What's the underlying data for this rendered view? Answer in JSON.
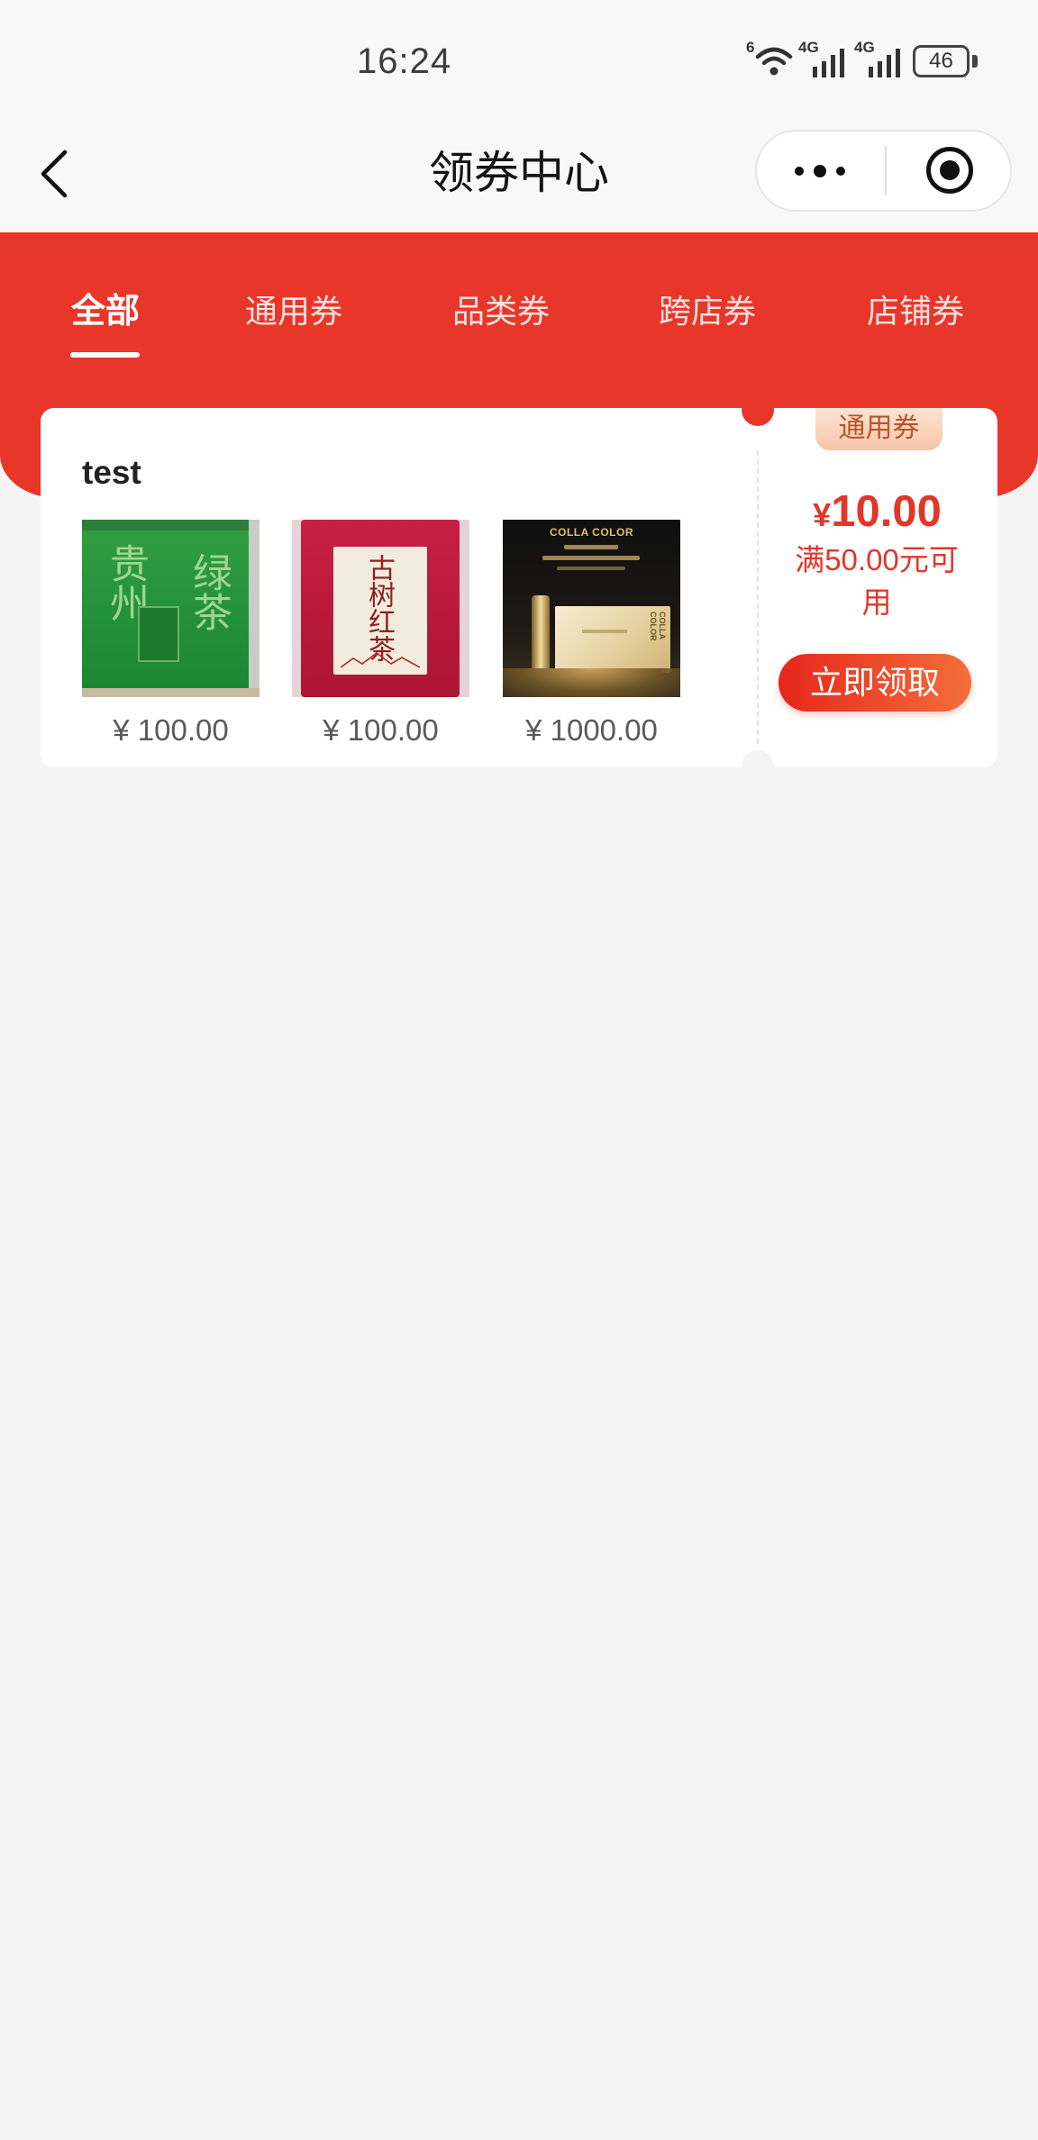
{
  "status_bar": {
    "time": "16:24",
    "wifi_badge": "6",
    "signal_1_label": "4G",
    "signal_2_label": "4G",
    "battery": "46",
    "icons": [
      "wifi-icon",
      "cell-signal-icon",
      "cell-signal-icon",
      "battery-icon"
    ]
  },
  "nav": {
    "title": "领券中心",
    "back_icon": "chevron-left-icon",
    "more_icon": "more-dots-icon",
    "close_icon": "target-circle-icon"
  },
  "colors": {
    "top_bar_bg": "#f8f8f8",
    "header_red": "#e8372a",
    "page_bg": "#f4f4f5",
    "price_red": "#e2362a",
    "badge_text": "#b8542a",
    "button_start": "#e5271c",
    "button_end": "#f46e3b"
  },
  "tabs": [
    {
      "label": "全部",
      "active": true
    },
    {
      "label": "通用券",
      "active": false
    },
    {
      "label": "品类券",
      "active": false
    },
    {
      "label": "跨店券",
      "active": false
    },
    {
      "label": "店铺券",
      "active": false
    }
  ],
  "coupon": {
    "title": "test",
    "products": [
      {
        "price": "¥ 100.00",
        "image": {
          "kind": "green-tea-bag",
          "calligraphy": [
            "贵州",
            "绿茶"
          ]
        }
      },
      {
        "price": "¥ 100.00",
        "image": {
          "kind": "red-tea-bag",
          "calligraphy": "古树红茶"
        }
      },
      {
        "price": "¥ 1000.00",
        "image": {
          "kind": "gold-gift-box",
          "brand": "COLLA COLOR"
        }
      }
    ],
    "badge": "通用券",
    "currency": "¥",
    "amount": "10.00",
    "condition": "满50.00元可用",
    "claim_label": "立即领取"
  }
}
